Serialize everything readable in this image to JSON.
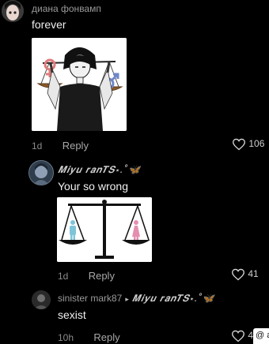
{
  "comments": [
    {
      "username": "диана фонвамп",
      "text": "forever",
      "time": "1d",
      "reply_label": "Reply",
      "likes": "106"
    },
    {
      "username": "𝑴𝒊𝒚𝒖 𝒓𝒂𝒏𝑻𝑺⋆.˚🦋",
      "text": "Your so wrong",
      "time": "1d",
      "reply_label": "Reply",
      "likes": "41"
    },
    {
      "username": "sinister mark87",
      "reply_to_arrow": "▸",
      "reply_to": "𝑴𝒊𝒚𝒖 𝒓𝒂𝒏𝑻𝑺⋆.˚🦋",
      "text": "sexist",
      "time": "10h",
      "reply_label": "Reply",
      "likes": "4"
    }
  ],
  "corner_overlay": "@ a",
  "colors": {
    "background": "#000000",
    "female_symbol": "#e07a7a",
    "male_symbol": "#6f86c9",
    "pink_figure": "#e48fb0",
    "blue_figure": "#7fc4d8"
  },
  "icons": {
    "like": "heart-outline-icon"
  }
}
